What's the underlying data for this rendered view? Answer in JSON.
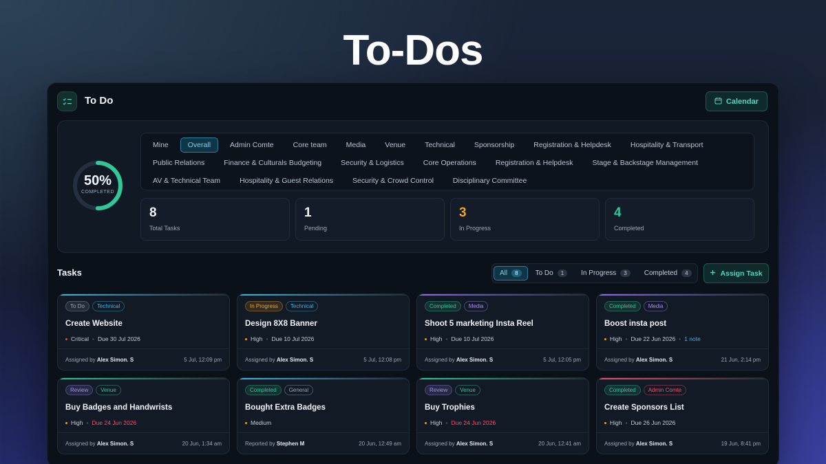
{
  "hero": {
    "title": "To-Dos"
  },
  "header": {
    "title": "To Do",
    "calendar_label": "Calendar"
  },
  "progress": {
    "percent_text": "50%",
    "label": "COMPLETED",
    "fraction": 0.5
  },
  "groups": [
    [
      "Mine",
      "Overall",
      "Admin Comte",
      "Core team",
      "Media",
      "Venue",
      "Technical",
      "Sponsorship",
      "Registration & Helpdesk",
      "Hospitality & Transport"
    ],
    [
      "Public Relations",
      "Finance & Culturals Budgeting",
      "Security & Logistics",
      "Core Operations",
      "Registration & Helpdesk",
      "Stage & Backstage Management"
    ],
    [
      "AV & Technical Team",
      "Hospitality & Guest Relations",
      "Security & Crowd Control",
      "Disciplinary Committee"
    ]
  ],
  "active_group": "Overall",
  "stats": [
    {
      "value": "8",
      "label": "Total Tasks",
      "color": "#f1f5f9"
    },
    {
      "value": "1",
      "label": "Pending",
      "color": "#f1f5f9"
    },
    {
      "value": "3",
      "label": "In Progress",
      "color": "#f5a524"
    },
    {
      "value": "4",
      "label": "Completed",
      "color": "#2fc897"
    }
  ],
  "tasks_section": {
    "title": "Tasks",
    "filters": [
      {
        "label": "All",
        "count": "8",
        "active": true
      },
      {
        "label": "To Do",
        "count": "1",
        "active": false
      },
      {
        "label": "In Progress",
        "count": "3",
        "active": false
      },
      {
        "label": "Completed",
        "count": "4",
        "active": false
      }
    ],
    "assign_label": "Assign Task"
  },
  "tasks": [
    {
      "status": "To Do",
      "status_color": "#9aa7b6",
      "tag": "Technical",
      "tag_color": "#3fb6e0",
      "accent": "#3fb6e0",
      "title": "Create Website",
      "priority": "Critical",
      "priority_color": "#ef4444",
      "due": "Due 30 Jul 2026",
      "due_color": "#c3ccd7",
      "note": "",
      "by_prefix": "Assigned by",
      "by": "Alex Simon. S",
      "time": "5 Jul, 12:09 pm"
    },
    {
      "status": "In Progress",
      "status_color": "#f5a524",
      "tag": "Technical",
      "tag_color": "#3fb6e0",
      "accent": "#3fb6e0",
      "title": "Design 8X8 Banner",
      "priority": "High",
      "priority_color": "#f59e0b",
      "due": "Due 10 Jul 2026",
      "due_color": "#c3ccd7",
      "note": "",
      "by_prefix": "Assigned by",
      "by": "Alex Simon. S",
      "time": "5 Jul, 12:08 pm"
    },
    {
      "status": "Completed",
      "status_color": "#2fc897",
      "tag": "Media",
      "tag_color": "#a78bfa",
      "accent": "#8b6cf0",
      "title": "Shoot 5 marketing Insta Reel",
      "priority": "High",
      "priority_color": "#f59e0b",
      "due": "Due 10 Jul 2026",
      "due_color": "#c3ccd7",
      "note": "",
      "by_prefix": "Assigned by",
      "by": "Alex Simon. S",
      "time": "5 Jul, 12:05 pm"
    },
    {
      "status": "Completed",
      "status_color": "#2fc897",
      "tag": "Media",
      "tag_color": "#a78bfa",
      "accent": "#8b6cf0",
      "title": "Boost insta post",
      "priority": "High",
      "priority_color": "#f59e0b",
      "due": "Due 22 Jun 2026",
      "due_color": "#c3ccd7",
      "note": "1 note",
      "by_prefix": "Assigned by",
      "by": "Alex Simon. S",
      "time": "21 Jun, 2:14 pm"
    },
    {
      "status": "Review",
      "status_color": "#a78bfa",
      "tag": "Venue",
      "tag_color": "#2fc897",
      "accent": "#2fc897",
      "title": "Buy Badges and Handwrists",
      "priority": "High",
      "priority_color": "#f59e0b",
      "due": "Due 24 Jun 2026",
      "due_color": "#f0506e",
      "note": "",
      "by_prefix": "Assigned by",
      "by": "Alex Simon. S",
      "time": "20 Jun, 1:34 am"
    },
    {
      "status": "Completed",
      "status_color": "#2fc897",
      "tag": "General",
      "tag_color": "#9aa7b6",
      "accent": "#3fb6e0",
      "title": "Bought Extra Badges",
      "priority": "Medium",
      "priority_color": "#f59e0b",
      "due": "",
      "due_color": "#c3ccd7",
      "note": "",
      "by_prefix": "Reported by",
      "by": "Stephen M",
      "time": "20 Jun, 12:49 am"
    },
    {
      "status": "Review",
      "status_color": "#a78bfa",
      "tag": "Venue",
      "tag_color": "#2fc897",
      "accent": "#2fc897",
      "title": "Buy Trophies",
      "priority": "High",
      "priority_color": "#f59e0b",
      "due": "Due 24 Jun 2026",
      "due_color": "#f0506e",
      "note": "",
      "by_prefix": "Assigned by",
      "by": "Alex Simon. S",
      "time": "20 Jun, 12:41 am"
    },
    {
      "status": "Completed",
      "status_color": "#2fc897",
      "tag": "Admin Comte",
      "tag_color": "#f0506e",
      "accent": "#f0506e",
      "title": "Create Sponsors List",
      "priority": "High",
      "priority_color": "#f59e0b",
      "due": "Due 26 Jun 2026",
      "due_color": "#c3ccd7",
      "note": "",
      "by_prefix": "Assigned by",
      "by": "Alex Simon. S",
      "time": "19 Jun, 8:41 pm"
    }
  ],
  "icons": {
    "logo": "checklist-icon",
    "calendar": "calendar-icon",
    "assign": "plus-icon"
  },
  "colors": {
    "accent": "#53d4c2",
    "active_blue": "#2a7fa1",
    "background": "#0b1119"
  }
}
